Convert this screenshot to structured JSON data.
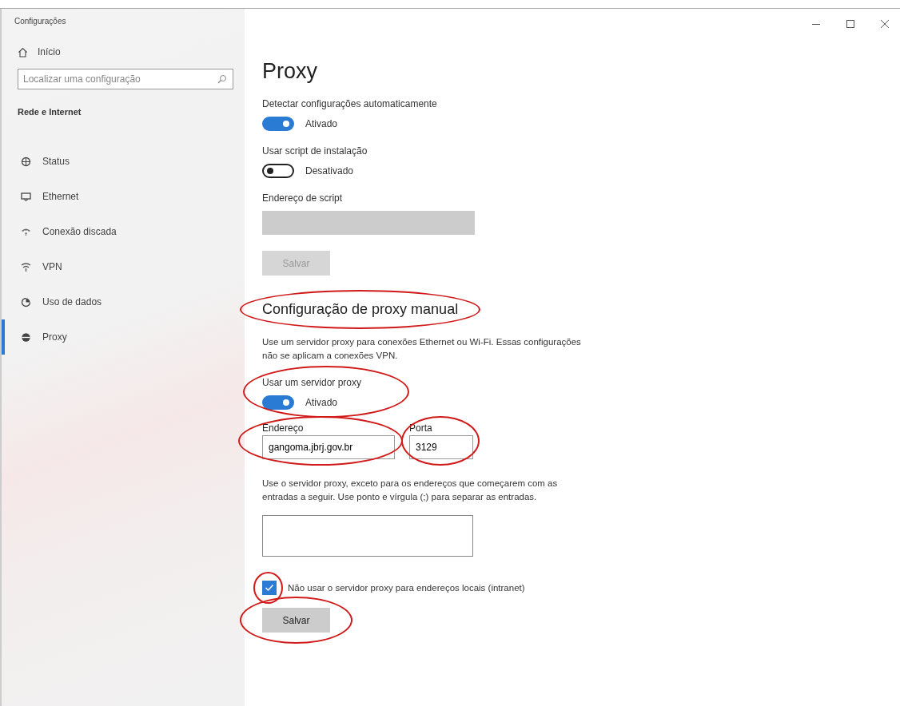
{
  "window": {
    "title": "Configurações"
  },
  "sidebar": {
    "home": "Início",
    "search": {
      "placeholder": "Localizar uma configuração"
    },
    "section": "Rede e Internet",
    "items": [
      {
        "kind": "status",
        "label": "Status",
        "selected": false
      },
      {
        "kind": "ethernet",
        "label": "Ethernet",
        "selected": false
      },
      {
        "kind": "dialup",
        "label": "Conexão discada",
        "selected": false
      },
      {
        "kind": "vpn",
        "label": "VPN",
        "selected": false
      },
      {
        "kind": "data",
        "label": "Uso de dados",
        "selected": false
      },
      {
        "kind": "proxy",
        "label": "Proxy",
        "selected": true
      }
    ]
  },
  "page": {
    "title": "Proxy",
    "blocks": [
      {
        "kind": "toggle",
        "label": "Detectar configurações automaticamente",
        "on": true,
        "state": "Ativado",
        "circled": false
      },
      {
        "kind": "toggle",
        "label": "Usar script de instalação",
        "on": false,
        "state": "Desativado",
        "circled": false
      },
      {
        "kind": "field",
        "label": "Endereço de script",
        "disabled": true
      },
      {
        "kind": "button",
        "label": "Salvar",
        "disabled": true,
        "circled": false
      },
      {
        "kind": "heading",
        "text": "Configuração de proxy manual",
        "circled": true
      },
      {
        "kind": "text",
        "text": "Use um servidor proxy para conexões Ethernet ou Wi-Fi. Essas configurações não se aplicam a conexões VPN."
      },
      {
        "kind": "toggle",
        "label": "Usar um servidor proxy",
        "on": true,
        "state": "Ativado",
        "circled": true
      },
      {
        "kind": "address",
        "fields": [
          {
            "label": "Endereço",
            "value": "gangoma.jbrj.gov.br",
            "circled": true
          },
          {
            "label": "Porta",
            "value": "3129",
            "circled": true
          }
        ]
      },
      {
        "kind": "text",
        "text": "Use o servidor proxy, exceto para os endereços que começarem com as entradas a seguir. Use ponto e vírgula (;) para separar as entradas."
      },
      {
        "kind": "textarea"
      },
      {
        "kind": "checkbox",
        "label": "Não usar o servidor proxy para endereços locais (intranet)",
        "checked": true,
        "circled": true
      },
      {
        "kind": "button",
        "label": "Salvar",
        "disabled": false,
        "circled": true
      }
    ]
  }
}
